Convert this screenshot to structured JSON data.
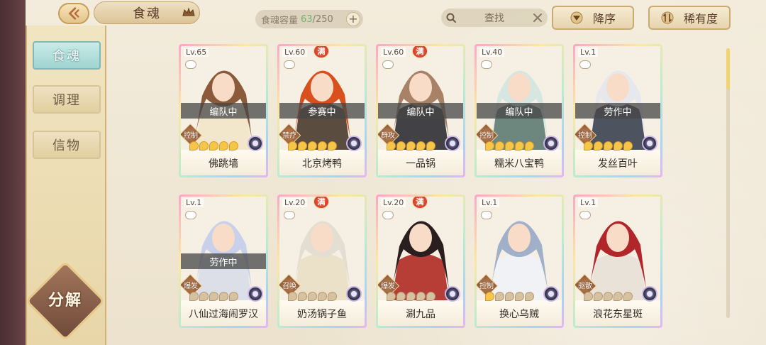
{
  "header": {
    "title": "食魂",
    "capacity_label": "食魂容量",
    "capacity_used": "63",
    "capacity_total": "/250",
    "search_label": "查找",
    "sort_desc_label": "降序",
    "sort_rarity_label": "稀有度"
  },
  "sidebar": {
    "tabs": [
      {
        "label": "食魂"
      },
      {
        "label": "调理"
      },
      {
        "label": "信物"
      }
    ],
    "decompose_label": "分解"
  },
  "colors": {
    "active_tab": "#9fd4d1",
    "star_on": "#f6c64b",
    "full_badge": "#c42f1f"
  },
  "cards": [
    {
      "level": "Lv.65",
      "name": "佛跳墙",
      "status": "编队中",
      "full": "",
      "role": "控制",
      "stars_on": 5,
      "hair": "#8a5a3a",
      "outfit": "#f2e6c8"
    },
    {
      "level": "Lv.60",
      "name": "北京烤鸭",
      "status": "参赛中",
      "full": "满",
      "role": "禁疗",
      "stars_on": 5,
      "hair": "#d8501e",
      "outfit": "#4a3a2e"
    },
    {
      "level": "Lv.60",
      "name": "一品锅",
      "status": "编队中",
      "full": "满",
      "role": "群攻",
      "stars_on": 5,
      "hair": "#a88266",
      "outfit": "#2e2e34"
    },
    {
      "level": "Lv.40",
      "name": "糯米八宝鸭",
      "status": "编队中",
      "full": "",
      "role": "控制",
      "stars_on": 5,
      "hair": "#d6e6e0",
      "outfit": "#5e7a72"
    },
    {
      "level": "Lv.1",
      "name": "发丝百叶",
      "status": "劳作中",
      "full": "",
      "role": "控制",
      "stars_on": 5,
      "hair": "#e6e8ee",
      "outfit": "#3c4250"
    },
    {
      "level": "Lv.1",
      "name": "八仙过海闹罗汉",
      "status": "劳作中",
      "full": "",
      "role": "爆发",
      "stars_on": 0,
      "hair": "#c9d0ea",
      "outfit": "#d9dce8"
    },
    {
      "level": "Lv.20",
      "name": "奶汤锅子鱼",
      "status": "",
      "full": "满",
      "role": "召唤",
      "stars_on": 0,
      "hair": "#e4ded2",
      "outfit": "#e9dfc4"
    },
    {
      "level": "Lv.20",
      "name": "涮九品",
      "status": "",
      "full": "满",
      "role": "爆发",
      "stars_on": 0,
      "hair": "#2a1e1e",
      "outfit": "#b02a24"
    },
    {
      "level": "Lv.1",
      "name": "换心乌贼",
      "status": "",
      "full": "",
      "role": "控制",
      "stars_on": 1,
      "hair": "#9fb0c8",
      "outfit": "#f0f2f6"
    },
    {
      "level": "Lv.1",
      "name": "浪花东星斑",
      "status": "",
      "full": "",
      "role": "驱散",
      "stars_on": 0,
      "hair": "#b0262a",
      "outfit": "#e8e0d6"
    }
  ]
}
